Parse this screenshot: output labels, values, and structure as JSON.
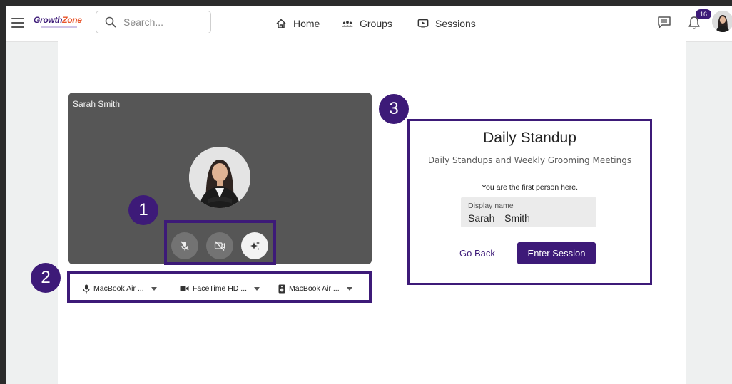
{
  "header": {
    "logo_part1": "Growth",
    "logo_part2": "Zone",
    "search_placeholder": "Search...",
    "nav": [
      {
        "label": "Home",
        "icon": "home-icon"
      },
      {
        "label": "Groups",
        "icon": "groups-icon"
      },
      {
        "label": "Sessions",
        "icon": "sessions-icon"
      }
    ],
    "chat_icon": "chat-icon",
    "notification_count": "16",
    "notification_icon": "bell-icon"
  },
  "video_preview": {
    "participant_name": "Sarah Smith",
    "controls": [
      {
        "name": "mic-off-icon",
        "state": "off"
      },
      {
        "name": "camera-off-icon",
        "state": "off"
      },
      {
        "name": "effects-icon",
        "state": "on"
      }
    ]
  },
  "devices": [
    {
      "icon": "microphone-icon",
      "label": "MacBook Air ..."
    },
    {
      "icon": "camera-icon",
      "label": "FaceTime HD ..."
    },
    {
      "icon": "speaker-icon",
      "label": "MacBook Air ..."
    }
  ],
  "callouts": [
    "1",
    "2",
    "3"
  ],
  "session_card": {
    "title": "Daily Standup",
    "subtitle": "Daily Standups and Weekly Grooming Meetings",
    "note": "You are the first person here.",
    "display_name_label": "Display name",
    "display_name_value": "Sarah  Smith",
    "go_back_label": "Go Back",
    "enter_label": "Enter Session"
  },
  "colors": {
    "accent": "#3d1a78",
    "video_bg": "#565656",
    "logo_orange": "#e8542a"
  }
}
